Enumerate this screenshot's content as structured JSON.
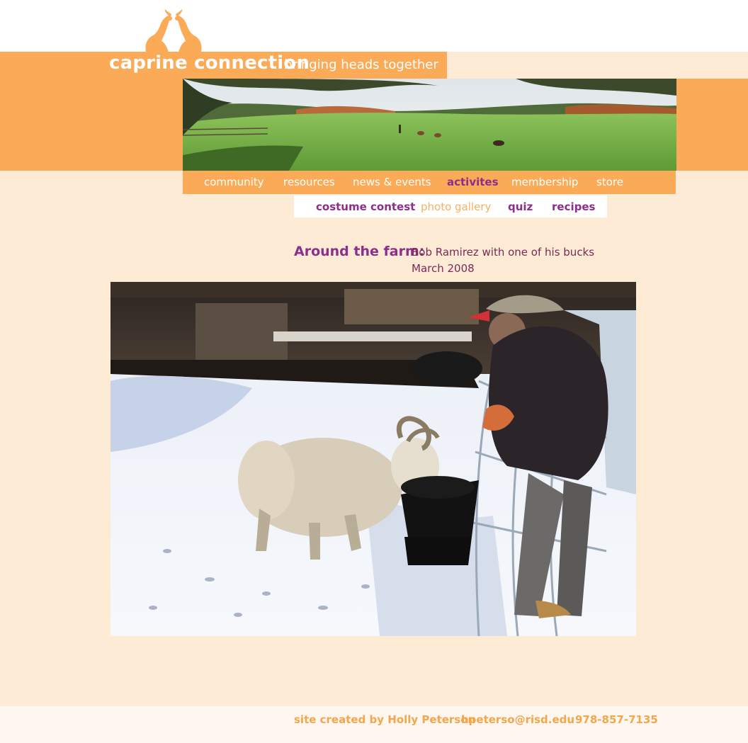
{
  "header": {
    "site_title": "caprine connection",
    "tagline": "bringing heads together",
    "accent_color": "#fbab57",
    "logo_icon": "twin-goats-logo-icon"
  },
  "nav": {
    "items": [
      {
        "label": "community"
      },
      {
        "label": "resources"
      },
      {
        "label": "news & events"
      },
      {
        "label": "activites"
      },
      {
        "label": "membership"
      },
      {
        "label": "store"
      }
    ],
    "active": "activites"
  },
  "subnav": {
    "items": [
      {
        "label": "costume contest"
      },
      {
        "label": "photo gallery"
      },
      {
        "label": "quiz"
      },
      {
        "label": "recipes"
      }
    ],
    "active": "photo gallery"
  },
  "caption": {
    "heading": "Around the farm:",
    "line1": "Bob Ramirez with one of his bucks",
    "line2": "March 2008"
  },
  "footer": {
    "credit": "site created by Holly Peterson",
    "email": "hpeterso@risd.edu",
    "phone": "978-857-7135"
  },
  "colors": {
    "purple": "#8b2f8a",
    "page_bg": "#fdebd6",
    "orange": "#fbab57"
  }
}
